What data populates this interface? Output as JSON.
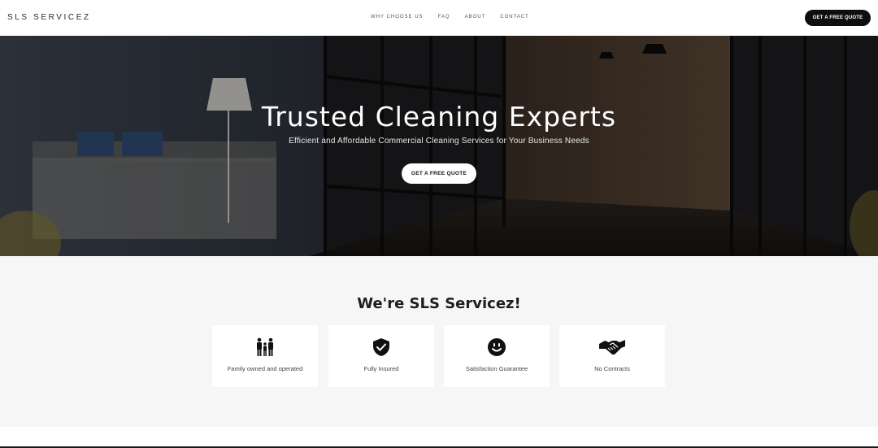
{
  "header": {
    "logo": "SLS SERVICEZ",
    "nav": [
      "WHY CHOOSE US",
      "FAQ",
      "ABOUT",
      "CONTACT"
    ],
    "cta": "GET A FREE QUOTE"
  },
  "hero": {
    "title": "Trusted Cleaning Experts",
    "subtitle": "Efficient and Affordable Commercial Cleaning Services for Your Business Needs",
    "cta": "GET A FREE QUOTE"
  },
  "about": {
    "title": "We're SLS Servicez!",
    "features": [
      {
        "label": "Family owned and operated",
        "icon": "family-icon"
      },
      {
        "label": "Fully Insured",
        "icon": "shield-check-icon"
      },
      {
        "label": "Satisfaction Guarantee",
        "icon": "smiley-icon"
      },
      {
        "label": "No Contracts",
        "icon": "handshake-icon"
      }
    ]
  },
  "colors": {
    "dark": "#0e0e0e",
    "text": "#1e1e1e",
    "section_bg": "#f6f6f6",
    "white": "#ffffff"
  }
}
